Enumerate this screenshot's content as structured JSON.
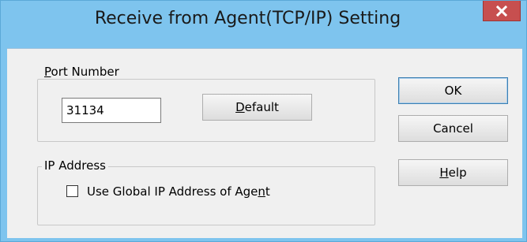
{
  "window": {
    "title": "Receive from Agent(TCP/IP) Setting",
    "close_glyph": "x"
  },
  "port_group": {
    "label_first": "P",
    "label_rest": "ort Number",
    "port_value": "31134",
    "default_button": {
      "label_first": "D",
      "label_rest": "efault"
    }
  },
  "ip_group": {
    "label": "IP Address",
    "checkbox": {
      "checked": false,
      "label_before": "Use Global IP Address of Age",
      "label_underlined": "n",
      "label_after": "t"
    }
  },
  "buttons": {
    "ok_label": "OK",
    "cancel_label": "Cancel",
    "help_first": "H",
    "help_rest": "elp"
  },
  "colors": {
    "titlebar": "#7ec4ee",
    "close_button": "#c74f4f",
    "dialog_face": "#f0f0f0",
    "default_button_border": "#3c7fb1"
  }
}
